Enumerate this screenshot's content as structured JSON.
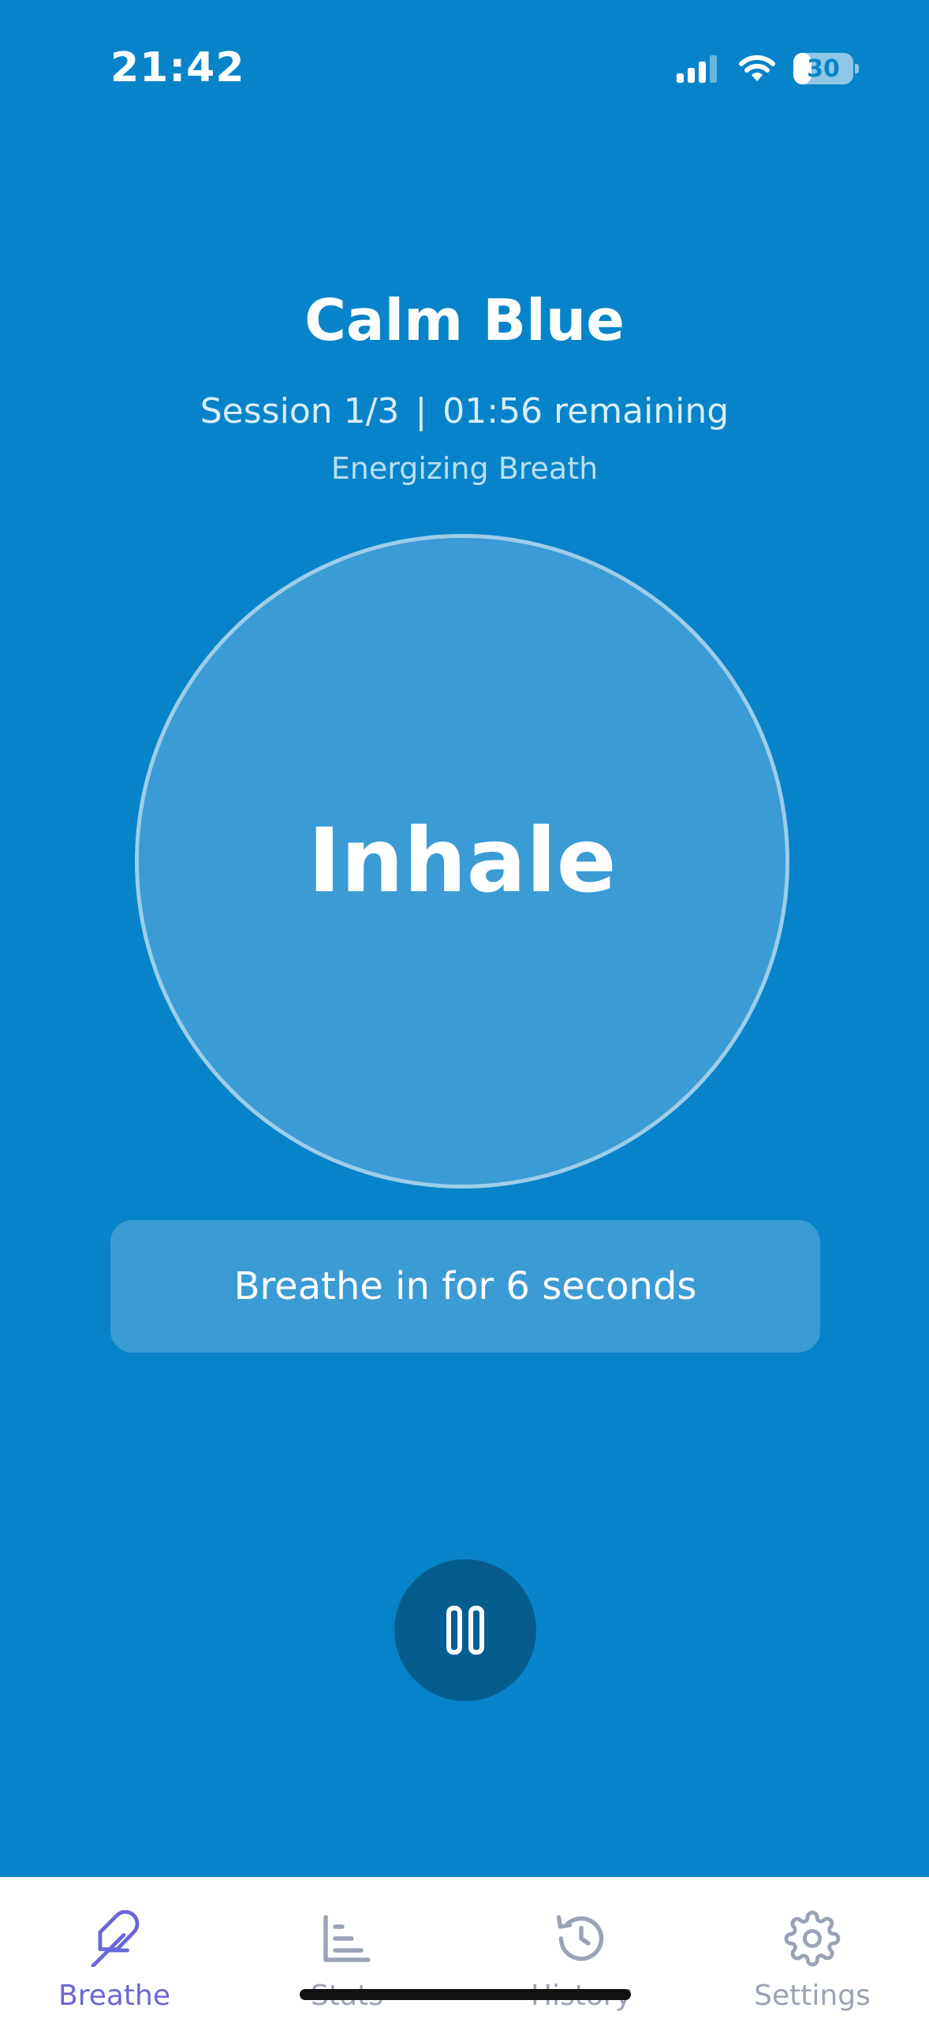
{
  "status_bar": {
    "time": "21:42",
    "battery_level": "30",
    "battery_fraction": 0.3,
    "signal_bars_active": 3,
    "signal_bars_total": 4
  },
  "session": {
    "title": "Calm Blue",
    "session_label": "Session 1/3",
    "separator": "|",
    "remaining": "01:56 remaining",
    "technique": "Energizing Breath"
  },
  "breath": {
    "phase": "Inhale",
    "instruction": "Breathe in for 6 seconds"
  },
  "controls": {
    "pause_icon": "pause-icon"
  },
  "tabs": [
    {
      "label": "Breathe",
      "icon": "feather-icon",
      "active": true
    },
    {
      "label": "Stats",
      "icon": "bar-chart-icon",
      "active": false
    },
    {
      "label": "History",
      "icon": "history-icon",
      "active": false
    },
    {
      "label": "Settings",
      "icon": "gear-icon",
      "active": false
    }
  ],
  "colors": {
    "background": "#0784c9",
    "circle": "#3a9bd5",
    "pause_button": "#055d8f",
    "tab_active": "#6a67d8",
    "tab_inactive": "#9aa3b5"
  }
}
